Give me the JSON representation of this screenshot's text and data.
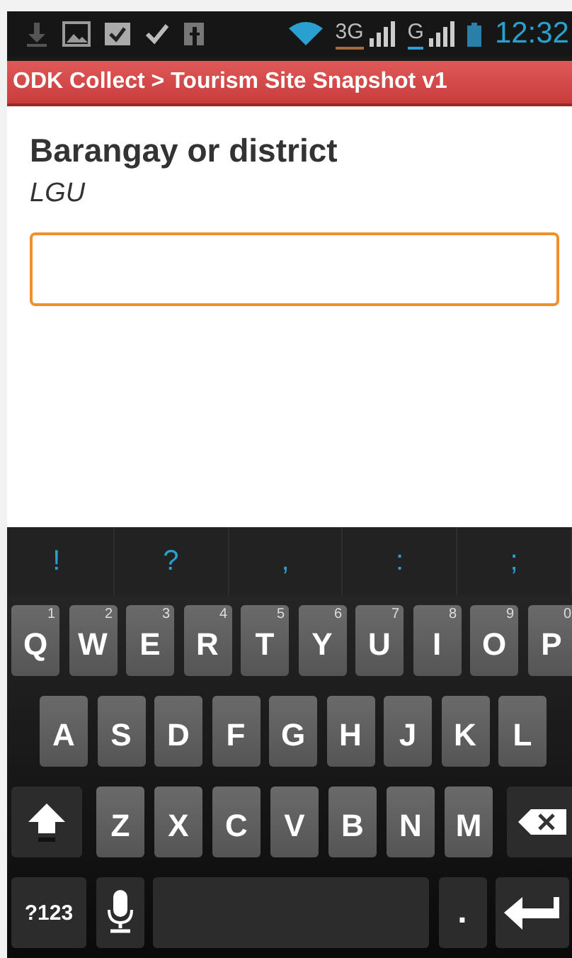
{
  "status_bar": {
    "networks": [
      "3G",
      "G"
    ],
    "time": "12:32"
  },
  "title_bar": {
    "title": "ODK Collect > Tourism Site Snapshot v1"
  },
  "question": {
    "label": "Barangay or district",
    "hint": "LGU"
  },
  "answer": {
    "focused": true
  },
  "keyboard": {
    "suggestions": [
      "!",
      "?",
      ",",
      ":",
      ";"
    ],
    "rows": [
      [
        {
          "kind": "letter",
          "label": "Q",
          "hint": "1"
        },
        {
          "kind": "letter",
          "label": "W",
          "hint": "2"
        },
        {
          "kind": "letter",
          "label": "E",
          "hint": "3"
        },
        {
          "kind": "letter",
          "label": "R",
          "hint": "4"
        },
        {
          "kind": "letter",
          "label": "T",
          "hint": "5"
        },
        {
          "kind": "letter",
          "label": "Y",
          "hint": "6"
        },
        {
          "kind": "letter",
          "label": "U",
          "hint": "7"
        },
        {
          "kind": "letter",
          "label": "I",
          "hint": "8"
        },
        {
          "kind": "letter",
          "label": "O",
          "hint": "9"
        },
        {
          "kind": "letter",
          "label": "P",
          "hint": "0"
        }
      ],
      [
        {
          "kind": "letter",
          "label": "A"
        },
        {
          "kind": "letter",
          "label": "S"
        },
        {
          "kind": "letter",
          "label": "D"
        },
        {
          "kind": "letter",
          "label": "F"
        },
        {
          "kind": "letter",
          "label": "G"
        },
        {
          "kind": "letter",
          "label": "H"
        },
        {
          "kind": "letter",
          "label": "J"
        },
        {
          "kind": "letter",
          "label": "K"
        },
        {
          "kind": "letter",
          "label": "L"
        }
      ],
      [
        {
          "kind": "shift"
        },
        {
          "kind": "letter",
          "label": "Z"
        },
        {
          "kind": "letter",
          "label": "X"
        },
        {
          "kind": "letter",
          "label": "C"
        },
        {
          "kind": "letter",
          "label": "V"
        },
        {
          "kind": "letter",
          "label": "B"
        },
        {
          "kind": "letter",
          "label": "N"
        },
        {
          "kind": "letter",
          "label": "M"
        },
        {
          "kind": "backspace"
        }
      ]
    ],
    "bottom_row": {
      "symbols_label": "?123",
      "period_label": "."
    }
  }
}
